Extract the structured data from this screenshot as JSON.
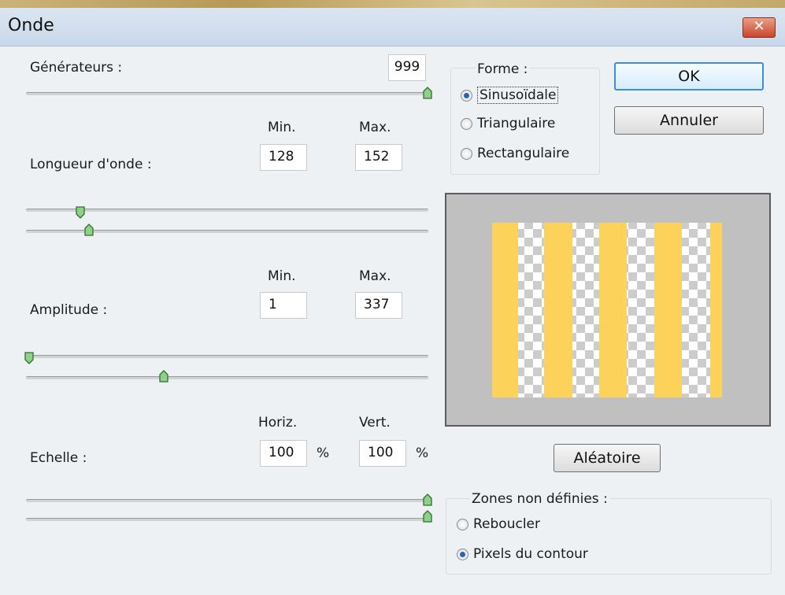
{
  "window": {
    "title": "Onde",
    "close_glyph": "✕"
  },
  "generators": {
    "label": "Générateurs :",
    "value": "999"
  },
  "wavelength": {
    "label": "Longueur d'onde :",
    "min_header": "Min.",
    "max_header": "Max.",
    "min_value": "128",
    "max_value": "152"
  },
  "amplitude": {
    "label": "Amplitude :",
    "min_header": "Min.",
    "max_header": "Max.",
    "min_value": "1",
    "max_value": "337"
  },
  "scale": {
    "label": "Echelle :",
    "horiz_header": "Horiz.",
    "vert_header": "Vert.",
    "horiz_value": "100",
    "vert_value": "100",
    "percent": "%"
  },
  "shape": {
    "label": "Forme :",
    "options": [
      "Sinusoïdale",
      "Triangulaire",
      "Rectangulaire"
    ],
    "selected": "Sinusoïdale"
  },
  "buttons": {
    "ok": "OK",
    "cancel": "Annuler",
    "randomize": "Aléatoire"
  },
  "undefined_areas": {
    "label": "Zones non définies :",
    "options": [
      "Reboucler",
      "Pixels du contour"
    ],
    "selected": "Pixels du contour"
  },
  "colors": {
    "stripe": "#fdd25b",
    "checker_light": "#ffffff",
    "checker_dark": "#cccccc",
    "slider_thumb": "#8fd08a",
    "accent": "#3a8fd6"
  }
}
